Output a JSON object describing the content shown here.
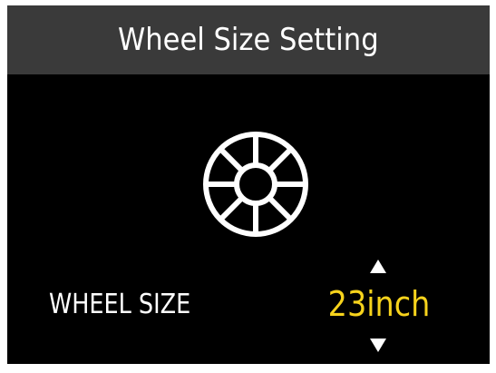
{
  "header": {
    "title": "Wheel Size Setting"
  },
  "icons": {
    "wheel": "wheel-icon",
    "up": "triangle-up-icon",
    "down": "triangle-down-icon"
  },
  "setting": {
    "label": "WHEEL SIZE",
    "value": "23inch"
  },
  "colors": {
    "background": "#000000",
    "title_bar": "#3a3a3a",
    "text": "#ffffff",
    "value": "#f7d31c"
  }
}
